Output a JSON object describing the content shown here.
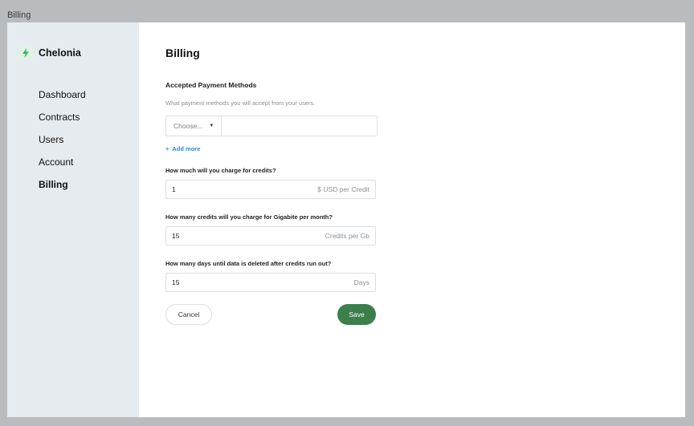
{
  "window": {
    "title": "Billing"
  },
  "brand": {
    "name": "Chelonia",
    "logo_icon": "lightning-bolt-icon",
    "logo_color": "#3cb35a"
  },
  "sidebar": {
    "items": [
      {
        "label": "Dashboard",
        "active": false
      },
      {
        "label": "Contracts",
        "active": false
      },
      {
        "label": "Users",
        "active": false
      },
      {
        "label": "Account",
        "active": false
      },
      {
        "label": "Billing",
        "active": true
      }
    ]
  },
  "main": {
    "title": "Billing",
    "payment": {
      "title": "Accepted Payment Methods",
      "description": "What payment methods you will accept from your users.",
      "select_placeholder": "Choose...",
      "input_value": "",
      "add_more": "Add more"
    },
    "questions": [
      {
        "label": "How much will you charge for credits?",
        "value": "1",
        "unit": "$ USD per Credit"
      },
      {
        "label": "How many credits will you charge for Gigabite per month?",
        "value": "15",
        "unit": "Credits per Gb"
      },
      {
        "label": "How many days until data is deleted after credits run out?",
        "value": "15",
        "unit": "Days"
      }
    ],
    "actions": {
      "cancel": "Cancel",
      "save": "Save"
    }
  },
  "colors": {
    "accent": "#3c7f4c",
    "link": "#2a8bd6",
    "sidebar_bg": "#e6ebef"
  }
}
